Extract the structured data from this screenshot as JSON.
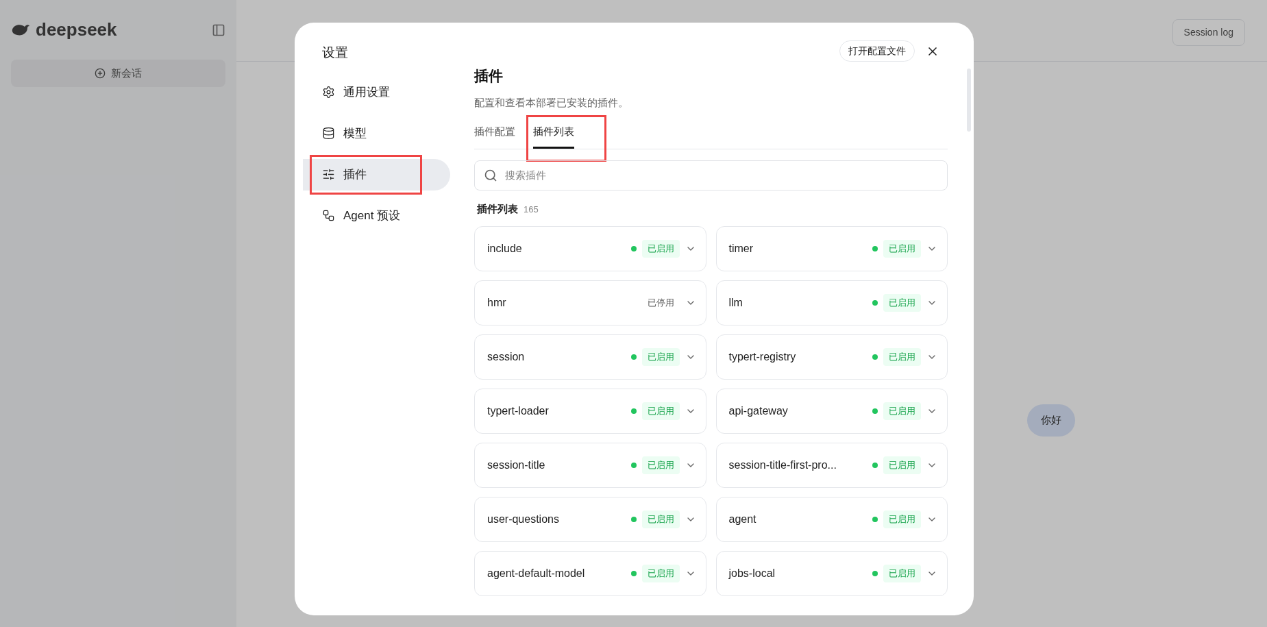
{
  "background": {
    "logo": "deepseek",
    "new_chat": "新会话",
    "session_log": "Session log",
    "message": "你好"
  },
  "dialog": {
    "title": "设置",
    "open_config": "打开配置文件",
    "nav": [
      {
        "label": "通用设置",
        "selected": false,
        "highlighted": false
      },
      {
        "label": "模型",
        "selected": false,
        "highlighted": false
      },
      {
        "label": "插件",
        "selected": true,
        "highlighted": true
      },
      {
        "label": "Agent 预设",
        "selected": false,
        "highlighted": false
      }
    ],
    "heading": "插件",
    "description": "配置和查看本部署已安装的插件。",
    "tabs": [
      {
        "label": "插件配置",
        "selected": false,
        "highlighted": false
      },
      {
        "label": "插件列表",
        "selected": true,
        "highlighted": true
      }
    ],
    "search": {
      "placeholder": "搜索插件"
    },
    "list_title": "插件列表",
    "count": "165",
    "plugins": [
      {
        "name": "include",
        "enabled": true,
        "status": "已启用"
      },
      {
        "name": "timer",
        "enabled": true,
        "status": "已启用"
      },
      {
        "name": "hmr",
        "enabled": false,
        "status": "已停用"
      },
      {
        "name": "llm",
        "enabled": true,
        "status": "已启用"
      },
      {
        "name": "session",
        "enabled": true,
        "status": "已启用"
      },
      {
        "name": "typert-registry",
        "enabled": true,
        "status": "已启用"
      },
      {
        "name": "typert-loader",
        "enabled": true,
        "status": "已启用"
      },
      {
        "name": "api-gateway",
        "enabled": true,
        "status": "已启用"
      },
      {
        "name": "session-title",
        "enabled": true,
        "status": "已启用"
      },
      {
        "name": "session-title-first-pro...",
        "enabled": true,
        "status": "已启用"
      },
      {
        "name": "user-questions",
        "enabled": true,
        "status": "已启用"
      },
      {
        "name": "agent",
        "enabled": true,
        "status": "已启用"
      },
      {
        "name": "agent-default-model",
        "enabled": true,
        "status": "已启用"
      },
      {
        "name": "jobs-local",
        "enabled": true,
        "status": "已启用"
      }
    ]
  }
}
